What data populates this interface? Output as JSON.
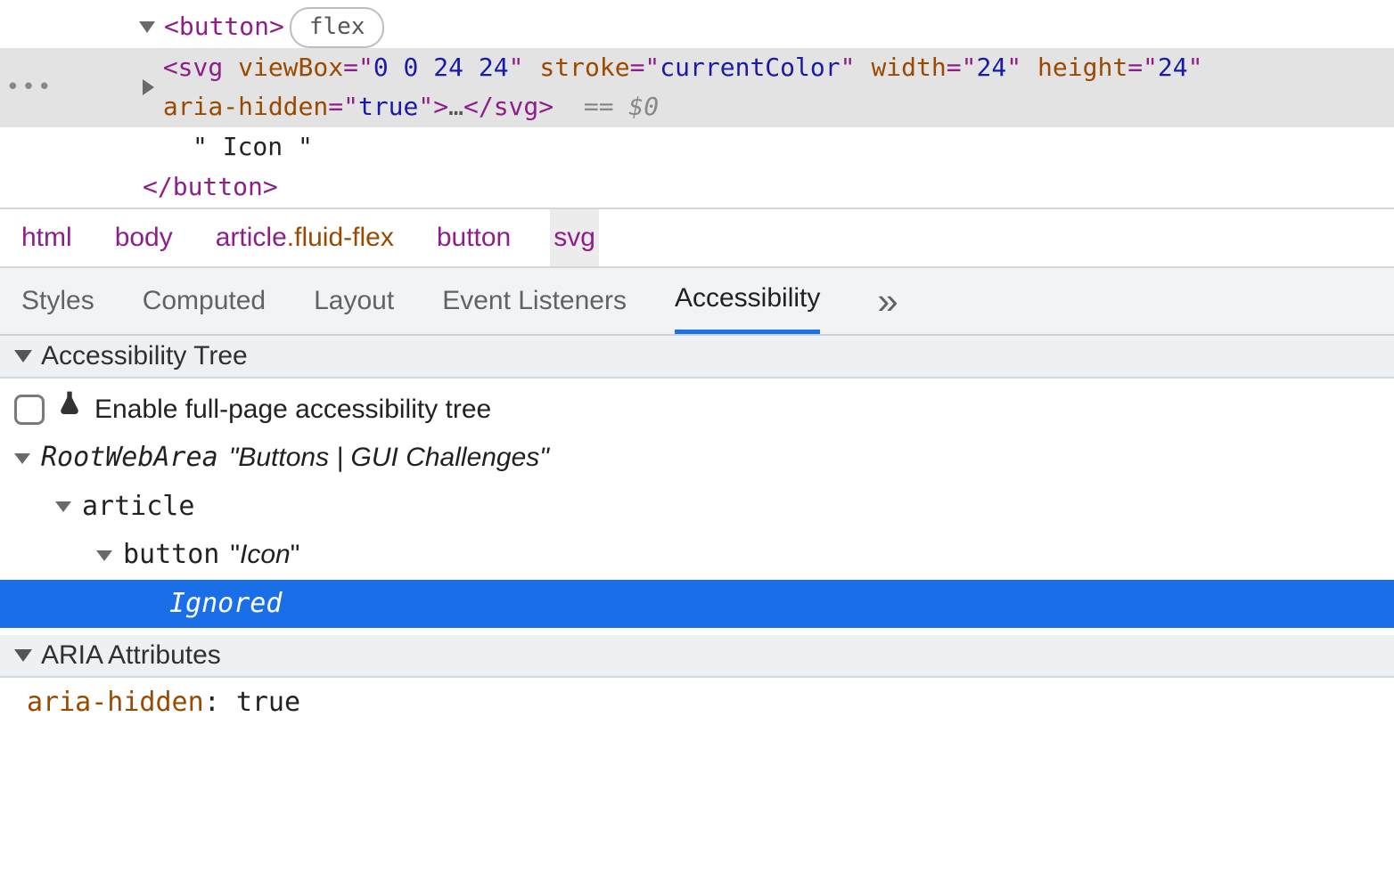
{
  "dom": {
    "gutter_ellipsis": "•••",
    "button_open": "<button>",
    "button_close": "</button>",
    "flex_badge": "flex",
    "svg": {
      "tag": "svg",
      "attrs": [
        {
          "name": "viewBox",
          "value": "0 0 24 24"
        },
        {
          "name": "stroke",
          "value": "currentColor"
        },
        {
          "name": "width",
          "value": "24"
        },
        {
          "name": "height",
          "value": "24"
        },
        {
          "name": "aria-hidden",
          "value": "true"
        }
      ],
      "ellipsis": "…",
      "close": "</svg>",
      "ghost": "== $0"
    },
    "text_node": "\" Icon \""
  },
  "breadcrumb": [
    {
      "label": "html"
    },
    {
      "label": "body"
    },
    {
      "label": "article",
      "class": ".fluid-flex"
    },
    {
      "label": "button"
    },
    {
      "label": "svg",
      "selected": true
    }
  ],
  "tabs": {
    "items": [
      "Styles",
      "Computed",
      "Layout",
      "Event Listeners",
      "Accessibility"
    ],
    "active": "Accessibility"
  },
  "sections": {
    "tree_header": "Accessibility Tree",
    "aria_header": "ARIA Attributes"
  },
  "a11y": {
    "enable_label": "Enable full-page accessibility tree",
    "root_role": "RootWebArea",
    "root_name": "\"Buttons | GUI Challenges\"",
    "article_role": "article",
    "button_role": "button",
    "button_name": "\"Icon\"",
    "ignored": "Ignored"
  },
  "aria_attrs": {
    "name": "aria-hidden",
    "sep": ": ",
    "value": "true"
  }
}
